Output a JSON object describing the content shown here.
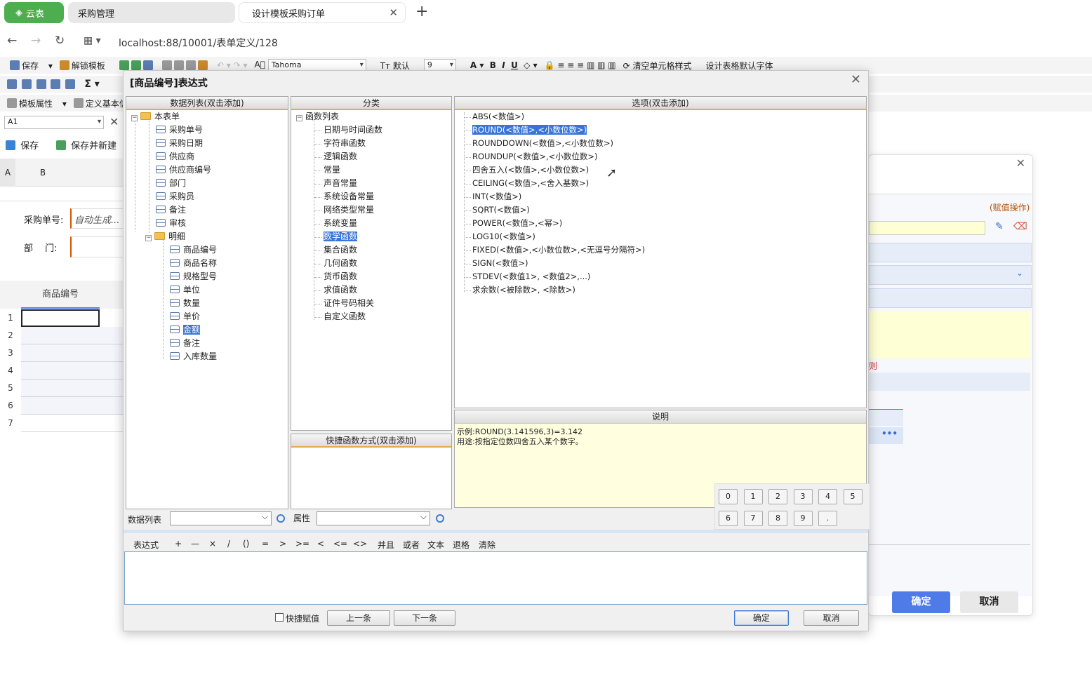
{
  "browser": {
    "app_tab": "云表",
    "tabs": [
      "采购管理",
      "设计模板采购订单"
    ],
    "url": "localhost:88/10001/表单定义/128"
  },
  "toolbar1": {
    "save": "保存",
    "unlock_template": "解锁模板",
    "font_name": "Tahoma",
    "default": "默认",
    "font_size": "9",
    "clear_style": "清空单元格样式",
    "design_font": "设计表格默认字体"
  },
  "toolbar3": {
    "template_props": "模板属性",
    "define_basic": "定义基本信"
  },
  "namebox": "A1",
  "actionbar": {
    "save": "保存",
    "save_new": "保存并新建"
  },
  "sheet": {
    "col_a": "A",
    "col_b": "B",
    "field_order_no": "采购单号:",
    "field_order_placeholder": "自动生成...",
    "field_dept": "部　 门:",
    "detail_header": "商品编号",
    "rows": [
      "1",
      "2",
      "3",
      "4",
      "5",
      "6",
      "7"
    ]
  },
  "bg_dialog": {
    "assign_label": "(赋值操作)",
    "ok": "确定",
    "cancel": "取消",
    "note_fragment": "则"
  },
  "dialog": {
    "title": "[商品编号]表达式",
    "data_list_header": "数据列表(双击添加)",
    "category_header": "分类",
    "options_header": "选项(双击添加)",
    "shortcut_header": "快捷函数方式(双击添加)",
    "desc_header": "说明",
    "tree": {
      "root": "本表单",
      "fields": [
        "采购单号",
        "采购日期",
        "供应商",
        "供应商编号",
        "部门",
        "采购员",
        "备注",
        "审核"
      ],
      "detail": "明细",
      "detail_fields": [
        "商品编号",
        "商品名称",
        "规格型号",
        "单位",
        "数量",
        "单价",
        "金额",
        "备注",
        "入库数量"
      ]
    },
    "categories": {
      "root": "函数列表",
      "items": [
        "日期与时间函数",
        "字符串函数",
        "逻辑函数",
        "常量",
        "声音常量",
        "系统设备常量",
        "网络类型常量",
        "系统变量",
        "数学函数",
        "集合函数",
        "几何函数",
        "货币函数",
        "求值函数",
        "证件号码相关",
        "自定义函数"
      ],
      "selected_index": 8
    },
    "options": {
      "items": [
        "ABS(<数值>)",
        "ROUND(<数值>,<小数位数>)",
        "ROUNDDOWN(<数值>,<小数位数>)",
        "ROUNDUP(<数值>,<小数位数>)",
        "四舍五入(<数值>,<小数位数>)",
        "CEILING(<数值>,<舍入基数>)",
        "INT(<数值>)",
        "SQRT(<数值>)",
        "POWER(<数值>,<幂>)",
        "LOG10(<数值>)",
        "FIXED(<数值>,<小数位数>,<无逗号分隔符>)",
        "SIGN(<数值>)",
        "STDEV(<数值1>, <数值2>,...)",
        "求余数(<被除数>, <除数>)"
      ],
      "selected_index": 1
    },
    "description": {
      "example": "示例:ROUND(3.141596,3)=3.142",
      "usage": "用途:按指定位数四舍五入某个数字。"
    },
    "numpad": [
      "0",
      "1",
      "2",
      "3",
      "4",
      "5",
      "6",
      "7",
      "8",
      "9",
      "."
    ],
    "data_list_label": "数据列表",
    "property_label": "属性",
    "operators": {
      "label": "表达式",
      "items": [
        "+",
        "—",
        "×",
        "/",
        "()",
        "=",
        ">",
        ">=",
        "<",
        "<=",
        "<>",
        "并且",
        "或者",
        "文本",
        "退格",
        "清除"
      ]
    },
    "expression_value": "",
    "quick_assign": "快捷赋值",
    "prev": "上一条",
    "next": "下一条",
    "ok": "确定",
    "cancel": "取消"
  }
}
